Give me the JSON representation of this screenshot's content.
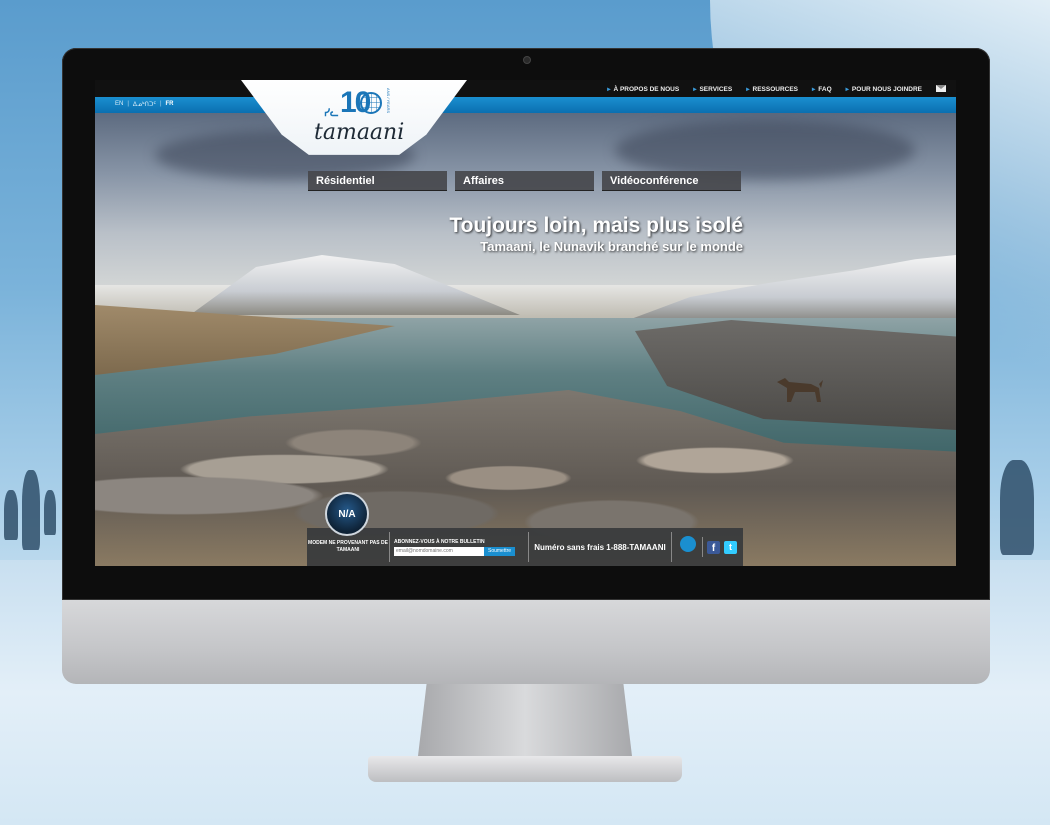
{
  "site": {
    "logo": {
      "name": "tamaani",
      "syllabics": "ᓯᓚ",
      "anniversary": "10",
      "anniversary_tagline": "ANS / YEARS"
    },
    "top_nav": [
      {
        "label": "À PROPOS DE NOUS",
        "icon": "arrow-icon"
      },
      {
        "label": "SERVICES",
        "icon": "arrow-icon"
      },
      {
        "label": "RESSOURCES",
        "icon": "arrow-icon"
      },
      {
        "label": "FAQ",
        "icon": "arrow-icon"
      },
      {
        "label": "POUR NOUS JOINDRE",
        "icon": "arrow-icon"
      }
    ],
    "languages": {
      "en": "EN",
      "iu": "ᐃᓄᒃᑎᑐᑦ",
      "fr": "FR",
      "active": "FR"
    },
    "tabs": [
      "Résidentiel",
      "Affaires",
      "Vidéoconférence"
    ],
    "headline": {
      "title": "Toujours loin, mais plus isolé",
      "subtitle": "Tamaani, le Nunavik branché sur le monde"
    },
    "footer": {
      "status_circle": "N/A",
      "modem_text": "MODEM NE PROVENANT PAS DE TAMAANI",
      "newsletter_label": "ABONNEZ-VOUS À NOTRE BULLETIN",
      "newsletter_placeholder": "email@nomdomaine.com",
      "newsletter_button": "Soumettre",
      "tollfree": "Numéro sans frais 1-888-TAMAANI",
      "social": [
        "facebook-icon",
        "twitter-icon"
      ]
    }
  },
  "colors": {
    "accent": "#1a8fd0",
    "dark_bar": "#111111",
    "tab_bg": "#46484c"
  }
}
